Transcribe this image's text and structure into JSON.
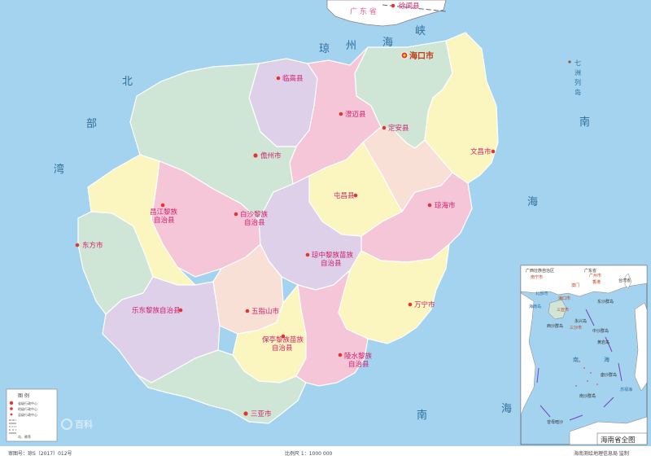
{
  "map": {
    "colors": {
      "sea": "#a4d3f0",
      "mainland": "#ffffff",
      "province_outline": "#8c7d7d",
      "capital_marker": "#e8322d",
      "county_marker": "#e8322d",
      "text_sea": "#2b6f9a",
      "text_county": "#d1206b"
    },
    "sea_labels": {
      "qiongzhou_1": "琼",
      "qiongzhou_2": "州",
      "qiongzhou_3": "海",
      "qiongzhou_4": "峡",
      "beibu_1": "北",
      "beibu_2": "部",
      "beibu_3": "湾",
      "nanhai_e1": "南",
      "nanhai_e2": "海",
      "nanhai_s1": "南",
      "nanhai_s2": "海",
      "qizhou_1": "七",
      "qizhou_2": "洲",
      "qizhou_3": "列",
      "qizhou_4": "岛"
    },
    "mainland_labels": {
      "guangdong": "广 东 省",
      "xuwen": "徐闻县"
    },
    "capital": {
      "name": "海口市"
    },
    "divisions": [
      {
        "key": "lingao",
        "name": "临高县",
        "color": "#ddd0e8"
      },
      {
        "key": "chengmai",
        "name": "澄迈县",
        "color": "#f5c6d8"
      },
      {
        "key": "ding_an",
        "name": "定安县",
        "color": "#f9e0d7"
      },
      {
        "key": "haikou",
        "name": "海口市",
        "color": "#cfe6d6"
      },
      {
        "key": "wenchang",
        "name": "文昌市",
        "color": "#fbf6bf"
      },
      {
        "key": "danzhou",
        "name": "儋州市",
        "color": "#cfe6d6"
      },
      {
        "key": "tunchang",
        "name": "屯昌县",
        "color": "#fbf6bf"
      },
      {
        "key": "qionghai",
        "name": "琼海市",
        "color": "#f5c6d8"
      },
      {
        "key": "changjiang",
        "name_lines": [
          "昌江黎族",
          "自治县"
        ],
        "color": "#fbf6bf"
      },
      {
        "key": "baisha",
        "name_lines": [
          "白沙黎族",
          "自治县"
        ],
        "color": "#f5c6d8"
      },
      {
        "key": "dongfang",
        "name": "东方市",
        "color": "#cfe6d6"
      },
      {
        "key": "qiongzhong",
        "name_lines": [
          "琼中黎族苗族",
          "自治县"
        ],
        "color": "#ddd0e8"
      },
      {
        "key": "wanning",
        "name": "万宁市",
        "color": "#fbf6bf"
      },
      {
        "key": "ledong",
        "name": "乐东黎族自治县",
        "color": "#ddd0e8"
      },
      {
        "key": "wuzhishan",
        "name": "五指山市",
        "color": "#f9e0d7"
      },
      {
        "key": "baoting",
        "name_lines": [
          "保亭黎族苗族",
          "自治县"
        ],
        "color": "#fbf6bf"
      },
      {
        "key": "lingshui",
        "name_lines": [
          "陵水黎族",
          "自治县"
        ],
        "color": "#f5c6d8"
      },
      {
        "key": "sanya",
        "name": "三亚市",
        "color": "#cfe6d6"
      }
    ],
    "legend": {
      "title": "图  例",
      "items": [
        "省级行政中心",
        "地级行政中心",
        "县级行政中心",
        "",
        "",
        "",
        "",
        "",
        "岛、礁等"
      ]
    },
    "inset": {
      "title": "海南省全图",
      "labels": {
        "guangxi": "广西壮族自治区",
        "guangdong": "广东省",
        "guangzhou": "广州市",
        "nanning": "南宁市",
        "hongkong": "香港",
        "macau": "澳门",
        "haikou": "海口市",
        "taiwan": "台湾省",
        "beibuwan": "北部湾",
        "hainan_dao": "海南岛",
        "sanya": "三亚市",
        "dongsha": "东沙群岛",
        "xisha": "西沙群岛",
        "sansha": "三沙市",
        "zhongsha": "中沙群岛",
        "huangyan": "黄岩岛",
        "yongxing": "永兴岛",
        "nanhai_1": "南",
        "nanhai_2": "海",
        "nansha": "南沙群岛",
        "zengmu": "曾母暗沙",
        "nansha_sub": "南沙群岛",
        "su_lu": "苏禄海"
      }
    },
    "footer": {
      "approval": "审图号：琼S（2017）012号",
      "scale": "比例尺 1：1000 000",
      "publisher": "海南测绘地理信息局 监制"
    },
    "watermark": {
      "text": "百科"
    }
  }
}
